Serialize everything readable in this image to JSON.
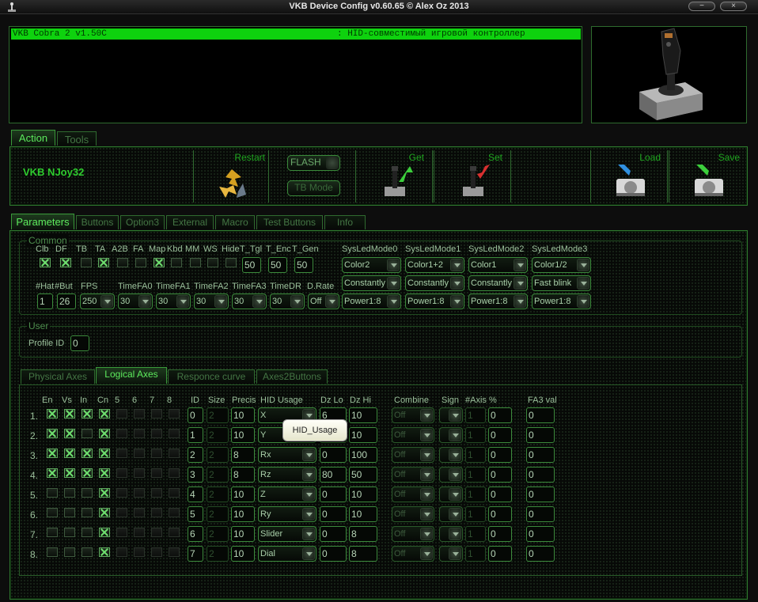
{
  "window": {
    "title": "VKB Device Config v0.60.65 © Alex Oz 2013"
  },
  "console": {
    "device": "VKB Cobra 2 v1.50C",
    "description": ": HID-совместимый игровой контроллер"
  },
  "main_tabs": [
    "Action",
    "Tools"
  ],
  "action": {
    "device_name": "VKB NJoy32",
    "restart": "Restart",
    "flash": "FLASH",
    "tb_mode": "TB Mode",
    "get": "Get",
    "set": "Set",
    "load": "Load",
    "save": "Save"
  },
  "param_tabs": [
    "Parameters",
    "Buttons",
    "Option3",
    "External",
    "Macro",
    "Test Buttons",
    "Info"
  ],
  "common": {
    "title": "Common",
    "flags": [
      {
        "label": "Clb",
        "checked": true
      },
      {
        "label": "DF",
        "checked": true
      },
      {
        "label": "TB",
        "checked": false
      },
      {
        "label": "TA",
        "checked": true
      },
      {
        "label": "A2B",
        "checked": false
      },
      {
        "label": "FA",
        "checked": false
      },
      {
        "label": "Map",
        "checked": true
      },
      {
        "label": "Kbd",
        "checked": false
      },
      {
        "label": "MM",
        "checked": false
      },
      {
        "label": "WS",
        "checked": false
      },
      {
        "label": "Hide",
        "checked": false
      }
    ],
    "t_tgl": {
      "label": "T_Tgl",
      "value": "50"
    },
    "t_enc": {
      "label": "T_Enc",
      "value": "50"
    },
    "t_gen": {
      "label": "T_Gen",
      "value": "50"
    },
    "hat": {
      "label": "#Hat",
      "value": "1"
    },
    "but": {
      "label": "#But",
      "value": "26"
    },
    "fps": {
      "label": "FPS",
      "value": "250"
    },
    "timefa0": {
      "label": "TimeFA0",
      "value": "30"
    },
    "timefa1": {
      "label": "TimeFA1",
      "value": "30"
    },
    "timefa2": {
      "label": "TimeFA2",
      "value": "30"
    },
    "timefa3": {
      "label": "TimeFA3",
      "value": "30"
    },
    "timedr": {
      "label": "TimeDR",
      "value": "30"
    },
    "drate": {
      "label": "D.Rate",
      "value": "Off"
    },
    "sysled": [
      {
        "label": "SysLedMode0",
        "color": "Color2",
        "mode": "Constantly",
        "power": "Power1:8"
      },
      {
        "label": "SysLedMode1",
        "color": "Color1+2",
        "mode": "Constantly",
        "power": "Power1:8"
      },
      {
        "label": "SysLedMode2",
        "color": "Color1",
        "mode": "Constantly",
        "power": "Power1:8"
      },
      {
        "label": "SysLedMode3",
        "color": "Color1/2",
        "mode": "Fast blink",
        "power": "Power1:8"
      }
    ]
  },
  "user": {
    "title": "User",
    "profile_label": "Profile ID",
    "profile_value": "0"
  },
  "axes_tabs": [
    "Physical Axes",
    "Logical Axes",
    "Responce curve",
    "Axes2Buttons"
  ],
  "axes": {
    "headers": {
      "en": "En",
      "vs": "Vs",
      "in": "In",
      "cn": "Cn",
      "c5": "5",
      "c6": "6",
      "c7": "7",
      "c8": "8",
      "id": "ID",
      "size": "Size",
      "precis": "Precis",
      "hid": "HID Usage",
      "dzlo": "Dz Lo",
      "dzhi": "Dz Hi",
      "combine": "Combine",
      "sign": "Sign",
      "naxis": "#Axis",
      "pct": "%",
      "fa3": "FA3 val"
    },
    "rows": [
      {
        "num": "1.",
        "en": true,
        "vs": true,
        "in": true,
        "cn": true,
        "id": "0",
        "size": "2",
        "precis": "10",
        "hid": "X",
        "dzlo": "6",
        "dzhi": "10",
        "combine": "Off",
        "naxis": "1",
        "pct": "0",
        "fa3": "0"
      },
      {
        "num": "2.",
        "en": true,
        "vs": true,
        "in": false,
        "cn": true,
        "id": "1",
        "size": "2",
        "precis": "10",
        "hid": "Y",
        "dzlo": "",
        "dzhi": "10",
        "combine": "Off",
        "naxis": "1",
        "pct": "0",
        "fa3": "0"
      },
      {
        "num": "3.",
        "en": true,
        "vs": true,
        "in": true,
        "cn": true,
        "id": "2",
        "size": "2",
        "precis": "8",
        "hid": "Rx",
        "dzlo": "0",
        "dzhi": "100",
        "combine": "Off",
        "naxis": "1",
        "pct": "0",
        "fa3": "0"
      },
      {
        "num": "4.",
        "en": true,
        "vs": true,
        "in": true,
        "cn": true,
        "id": "3",
        "size": "2",
        "precis": "8",
        "hid": "Rz",
        "dzlo": "80",
        "dzhi": "50",
        "combine": "Off",
        "naxis": "1",
        "pct": "0",
        "fa3": "0"
      },
      {
        "num": "5.",
        "en": false,
        "vs": false,
        "in": false,
        "cn": true,
        "id": "4",
        "size": "2",
        "precis": "10",
        "hid": "Z",
        "dzlo": "0",
        "dzhi": "10",
        "combine": "Off",
        "naxis": "1",
        "pct": "0",
        "fa3": "0"
      },
      {
        "num": "6.",
        "en": false,
        "vs": false,
        "in": false,
        "cn": true,
        "id": "5",
        "size": "2",
        "precis": "10",
        "hid": "Ry",
        "dzlo": "0",
        "dzhi": "10",
        "combine": "Off",
        "naxis": "1",
        "pct": "0",
        "fa3": "0"
      },
      {
        "num": "7.",
        "en": false,
        "vs": false,
        "in": false,
        "cn": true,
        "id": "6",
        "size": "2",
        "precis": "10",
        "hid": "Slider",
        "dzlo": "0",
        "dzhi": "8",
        "combine": "Off",
        "naxis": "1",
        "pct": "0",
        "fa3": "0"
      },
      {
        "num": "8.",
        "en": false,
        "vs": false,
        "in": false,
        "cn": true,
        "id": "7",
        "size": "2",
        "precis": "10",
        "hid": "Dial",
        "dzlo": "0",
        "dzhi": "8",
        "combine": "Off",
        "naxis": "1",
        "pct": "0",
        "fa3": "0"
      }
    ]
  },
  "tooltip": "HID_Usage",
  "icons": {
    "app": "joystick-icon",
    "restart": "recycle-icon",
    "get": "joystick-get-icon",
    "set": "joystick-set-icon",
    "load": "disk-load-icon",
    "save": "disk-save-icon"
  },
  "colors": {
    "accent": "#2f7a2f",
    "highlight": "#0ed20e",
    "background": "#0d0d0d"
  }
}
